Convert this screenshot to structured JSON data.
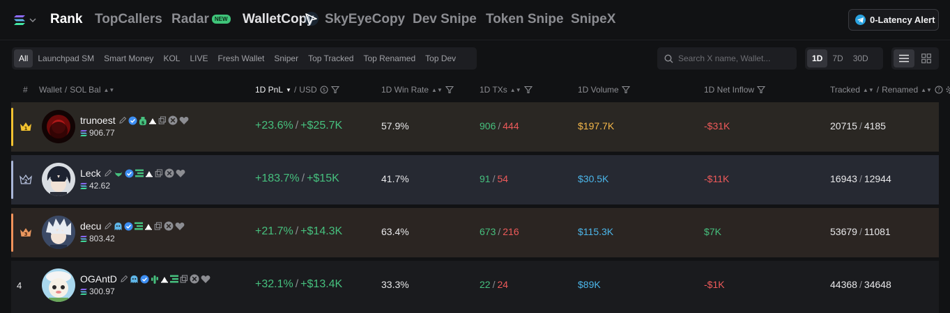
{
  "nav": {
    "items": [
      "Rank",
      "TopCallers",
      "Radar",
      "WalletCopy",
      "SkyEyeCopy",
      "Dev Snipe",
      "Token Snipe",
      "SnipeX"
    ],
    "new_badge": "NEW",
    "alert_button": "0-Latency Alert"
  },
  "filters": {
    "chips": [
      "All",
      "Launchpad SM",
      "Smart Money",
      "KOL",
      "LIVE",
      "Fresh Wallet",
      "Sniper",
      "Top Tracked",
      "Top Renamed",
      "Top Dev"
    ],
    "active": "All"
  },
  "search": {
    "placeholder": "Search X name, Wallet..."
  },
  "period": {
    "options": [
      "1D",
      "7D",
      "30D"
    ],
    "active": "1D"
  },
  "columns": {
    "num": "#",
    "wallet": "Wallet",
    "sol_bal": "SOL Bal",
    "pnl": "1D PnL",
    "usd": "USD",
    "win_rate": "1D Win Rate",
    "txs": "1D TXs",
    "volume": "1D Volume",
    "inflow": "1D Net Inflow",
    "tracked": "Tracked",
    "renamed": "Renamed",
    "slash": "/"
  },
  "rows": [
    {
      "rank": "1",
      "name": "trunoest",
      "bal": "906.77",
      "pnl_pct": "+23.6%",
      "pnl_usd": "+$25.7K",
      "win": "57.9%",
      "tx_buy": "906",
      "tx_sell": "444",
      "volume": "$197.7K",
      "inflow": "-$31K",
      "tracked": "20715",
      "renamed": "4185"
    },
    {
      "rank": "2",
      "name": "Leck",
      "bal": "42.62",
      "pnl_pct": "+183.7%",
      "pnl_usd": "+$15K",
      "win": "41.7%",
      "tx_buy": "91",
      "tx_sell": "54",
      "volume": "$30.5K",
      "inflow": "-$11K",
      "tracked": "16943",
      "renamed": "12944"
    },
    {
      "rank": "3",
      "name": "decu",
      "bal": "803.42",
      "pnl_pct": "+21.7%",
      "pnl_usd": "+$14.3K",
      "win": "63.4%",
      "tx_buy": "673",
      "tx_sell": "216",
      "volume": "$115.3K",
      "inflow": "$7K",
      "tracked": "53679",
      "renamed": "11081"
    },
    {
      "rank": "4",
      "name": "OGAntD",
      "bal": "300.97",
      "pnl_pct": "+32.1%",
      "pnl_usd": "+$13.4K",
      "win": "33.3%",
      "tx_buy": "22",
      "tx_sell": "24",
      "volume": "$89K",
      "inflow": "-$1K",
      "tracked": "44368",
      "renamed": "34648"
    }
  ],
  "colors": {
    "row1_bg": "#2a2723",
    "row1_bar": "#f2c230",
    "row2_bg": "#262932",
    "row2_bar": "#a9b6d8",
    "row3_bg": "#2b2522",
    "row3_bar": "#f0925a",
    "row4_bg": "#1a1b1e",
    "positive": "#46c07e",
    "negative": "#ee5a5a",
    "volume_gold": "#f5b84a",
    "volume_blue": "#4cb6ea"
  }
}
